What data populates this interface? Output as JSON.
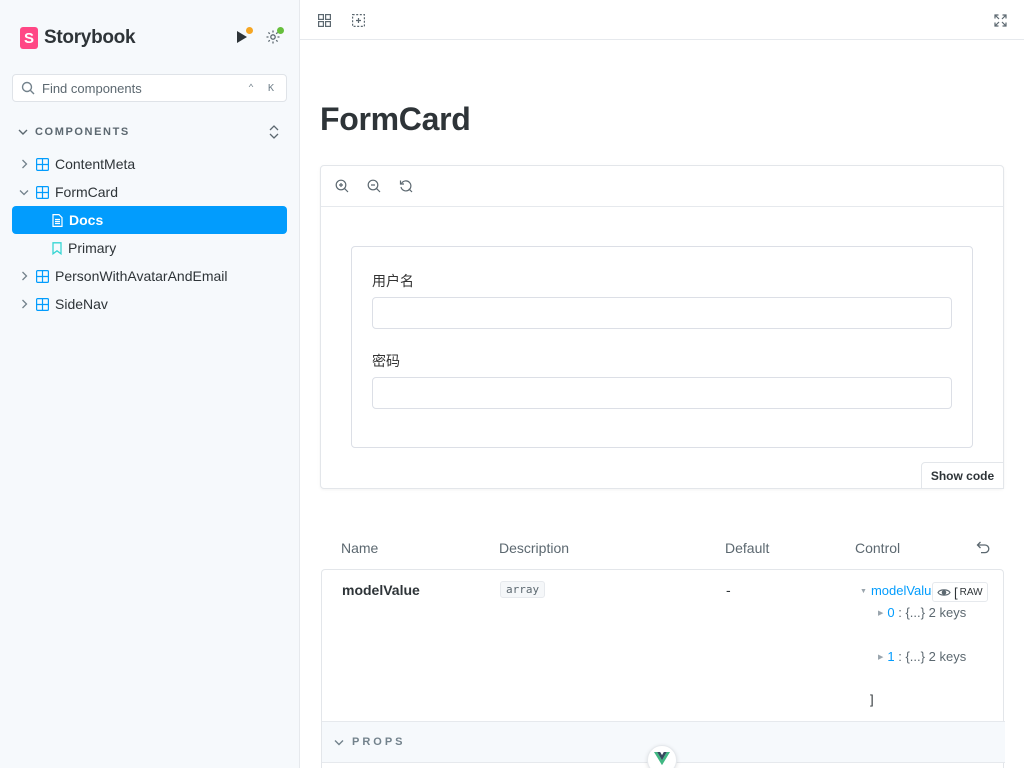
{
  "sidebar": {
    "brand": {
      "logo_letter": "S",
      "name": "Storybook"
    },
    "icons": {
      "run": "play-icon",
      "settings": "gear-icon"
    },
    "search": {
      "placeholder": "Find components",
      "shortcut": "⌃ K"
    },
    "section": {
      "label": "COMPONENTS"
    },
    "tree": [
      {
        "label": "ContentMeta",
        "kind": "component",
        "expanded": false
      },
      {
        "label": "FormCard",
        "kind": "component",
        "expanded": true
      },
      {
        "label": "Docs",
        "kind": "docs",
        "selected": true
      },
      {
        "label": "Primary",
        "kind": "story"
      },
      {
        "label": "PersonWithAvatarAndEmail",
        "kind": "component",
        "expanded": false
      },
      {
        "label": "SideNav",
        "kind": "component",
        "expanded": false
      }
    ]
  },
  "main": {
    "title": "FormCard",
    "preview": {
      "fields": [
        {
          "label": "用户名",
          "value": ""
        },
        {
          "label": "密码",
          "value": ""
        }
      ],
      "show_code": "Show code"
    },
    "args_table": {
      "headers": [
        "Name",
        "Description",
        "Default",
        "Control"
      ],
      "row": {
        "name": "modelValue",
        "type": "array",
        "default": "-",
        "control": {
          "root_key": "modelValue",
          "open_bracket": "[",
          "raw_label": "RAW",
          "items": [
            {
              "key": "0",
              "summary": "{...}",
              "count": "2 keys"
            },
            {
              "key": "1",
              "summary": "{...}",
              "count": "2 keys"
            }
          ],
          "close_bracket": "]"
        }
      },
      "section_label": "PROPS"
    }
  },
  "colors": {
    "accent": "#029cfd",
    "brand": "#ff4785",
    "sidebar_bg": "#f6f9fc",
    "component_icon": "#029cfd",
    "story_icon": "#37d5d3"
  }
}
